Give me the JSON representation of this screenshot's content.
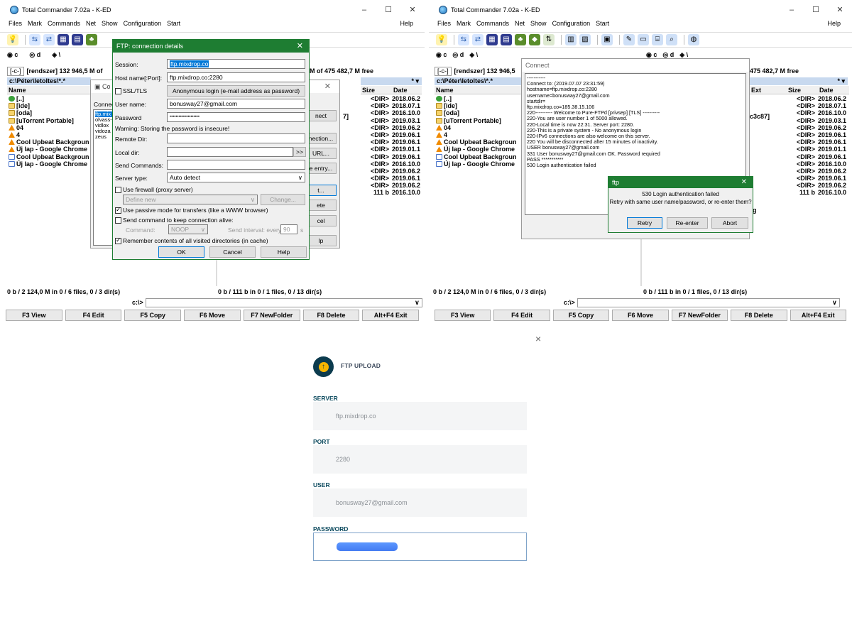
{
  "left": {
    "title": "Total Commander 7.02a - K-ED",
    "menu": [
      "Files",
      "Mark",
      "Commands",
      "Net",
      "Show",
      "Configuration",
      "Start"
    ],
    "help": "Help",
    "drives": [
      "c",
      "d",
      "\\"
    ],
    "path_combo": "[-c-]",
    "path_label": "[rendszer]  132 946,5 M of",
    "right_free": "M of 475 482,7 M free",
    "left_path": "c:\\Péter\\letoltes\\*.*",
    "col_name": "Name",
    "col_size": "Size",
    "col_date": "Date",
    "files": [
      {
        "icon": "up",
        "name": "[..]"
      },
      {
        "icon": "dir",
        "name": "[ide]"
      },
      {
        "icon": "dir",
        "name": "[oda]"
      },
      {
        "icon": "dir",
        "name": "[uTorrent Portable]"
      },
      {
        "icon": "vlc",
        "name": "04"
      },
      {
        "icon": "vlc",
        "name": "4"
      },
      {
        "icon": "vlc",
        "name": "Cool Upbeat Backgroun"
      },
      {
        "icon": "vlc",
        "name": "Új lap - Google Chrome"
      },
      {
        "icon": "doc",
        "name": "Cool Upbeat Backgroun"
      },
      {
        "icon": "doc",
        "name": "Új lap - Google Chrome"
      }
    ],
    "right_rows": [
      {
        "size": "<DIR>",
        "date": "2018.06.2"
      },
      {
        "size": "<DIR>",
        "date": "2018.07.1"
      },
      {
        "size": "<DIR>",
        "date": "2016.10.0"
      },
      {
        "size": "<DIR>",
        "date": "2019.03.1"
      },
      {
        "size": "<DIR>",
        "date": "2019.06.2"
      },
      {
        "size": "<DIR>",
        "date": "2019.06.1"
      },
      {
        "size": "<DIR>",
        "date": "2019.06.1"
      },
      {
        "size": "<DIR>",
        "date": "2019.01.1"
      },
      {
        "size": "<DIR>",
        "date": "2019.06.1"
      },
      {
        "size": "<DIR>",
        "date": "2016.10.0"
      },
      {
        "size": "<DIR>",
        "date": "2019.06.2"
      },
      {
        "size": "<DIR>",
        "date": "2019.06.1"
      },
      {
        "size": "<DIR>",
        "date": "2019.06.2"
      },
      {
        "size": "111 b",
        "date": "2016.10.0"
      }
    ],
    "frag_b7": "7]",
    "status_left": "0 b / 2 124,0 M in 0 / 6 files, 0 / 3 dir(s)",
    "status_right": "0 b / 111 b in 0 / 1 files, 0 / 13 dir(s)",
    "cmd_path": "c:\\>",
    "fkeys": [
      "F3 View",
      "F4 Edit",
      "F5 Copy",
      "F6 Move",
      "F7 NewFolder",
      "F8 Delete",
      "Alt+F4 Exit"
    ],
    "conn_dlg": {
      "title": "Co",
      "label": "Connect",
      "list": [
        "ftp.mix",
        "olvass-",
        "vidlox",
        "vidoza",
        "zeus"
      ],
      "btns": [
        "nect",
        "nection...",
        "URL...",
        "e entry...",
        "t...",
        "ete",
        "cel",
        "lp"
      ]
    },
    "ftp_dlg": {
      "title": "FTP: connection details",
      "session_label": "Session:",
      "session": "ftp.mixdrop.co",
      "host_label": "Host name[:Port]:",
      "host": "ftp.mixdrop.co:2280",
      "ssl_label": "SSL/TLS",
      "anon_btn": "Anonymous login (e-mail address as password)",
      "user_label": "User name:",
      "user": "bonusway27@gmail.com",
      "pass_label": "Password",
      "pass": "••••••••••••••••••••",
      "warning": "Warning: Storing the password is insecure!",
      "remote_label": "Remote Dir:",
      "local_label": "Local dir:",
      "send_label": "Send Commands:",
      "server_label": "Server type:",
      "server_type": "Auto detect",
      "firewall_label": "Use firewall (proxy server)",
      "define_new": "Define new",
      "change_btn": "Change...",
      "passive_label": "Use passive mode for transfers (like a WWW browser)",
      "keepalive_label": "Send command to keep connection alive:",
      "command_label": "Command:",
      "command": "NOOP",
      "interval_label": "Send interval: every",
      "interval": "90",
      "interval_unit": "s",
      "remember_label": "Remember contents of all visited directories (in cache)",
      "ok": "OK",
      "cancel": "Cancel",
      "help": "Help"
    }
  },
  "right": {
    "title": "Total Commander 7.02a - K-ED",
    "menu": [
      "Files",
      "Mark",
      "Commands",
      "Net",
      "Show",
      "Configuration",
      "Start"
    ],
    "help": "Help",
    "path_combo": "[-c-]",
    "path_label": "[rendszer]  132 946,5",
    "right_free": "475 482,7 M free",
    "left_path": "c:\\Péter\\letoltes\\*.*",
    "col_name": "Name",
    "col_ext": "Ext",
    "col_size": "Size",
    "col_date": "Date",
    "frag_c3": "c3c87]",
    "frag_g": "g",
    "connect_title": "Connect",
    "log": [
      "-----------",
      "Connect to: (2019.07.07 23:31:59)",
      "hostname=ftp.mixdrop.co:2280",
      "username=bonusway27@gmail.com",
      "startdir=",
      "ftp.mixdrop.co=185.38.15.106",
      "220---------- Welcome to Pure-FTPd [privsep] [TLS] ----------",
      "220-You are user number 1 of 5000 allowed.",
      "220-Local time is now 22:31. Server port: 2280.",
      "220-This is a private system - No anonymous login",
      "220-IPv6 connections are also welcome on this server.",
      "220 You will be disconnected after 15 minutes of inactivity.",
      "USER bonusway27@gmail.com",
      "331 User bonusway27@gmail.com OK. Password required",
      "PASS ***********",
      "530 Login authentication failed"
    ],
    "ftp_popup": {
      "title": "ftp",
      "line1": "530 Login authentication failed",
      "line2": "Retry with same user name/password, or re-enter them?",
      "retry": "Retry",
      "reenter": "Re-enter",
      "abort": "Abort"
    }
  },
  "modal": {
    "close": "×",
    "title": "FTP UPLOAD",
    "server_label": "SERVER",
    "server": "ftp.mixdrop.co",
    "port_label": "PORT",
    "port": "2280",
    "user_label": "USER",
    "user": "bonusway27@gmail.com",
    "password_label": "PASSWORD"
  },
  "colors": {
    "ftp_green": "#1e7d32",
    "modal_label": "#0c4a5e",
    "selection": "#0078d7"
  }
}
